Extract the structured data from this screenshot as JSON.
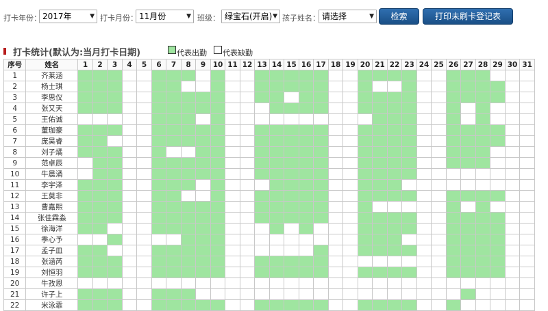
{
  "filters": {
    "year_label": "打卡年份：",
    "year_value": "2017年",
    "month_label": "打卡月份：",
    "month_value": "11月份",
    "class_label": "班级：",
    "class_value": "绿宝石(开启)",
    "child_label": "孩子姓名：",
    "child_value": "请选择",
    "search_button": "检索",
    "print_button": "打印未刷卡登记表"
  },
  "section": {
    "title": "打卡统计(默认为:当月打卡日期)",
    "legend_present": "代表出勤",
    "legend_absent": "代表缺勤"
  },
  "colors": {
    "present": "#9fe5a0",
    "absent": "#ffffff",
    "button": "#1f5a96",
    "title_bar": "#b71c1c"
  },
  "table": {
    "header_index": "序号",
    "header_name": "姓名",
    "days": [
      "1",
      "2",
      "3",
      "4",
      "5",
      "6",
      "7",
      "8",
      "9",
      "10",
      "11",
      "12",
      "13",
      "14",
      "15",
      "16",
      "17",
      "18",
      "19",
      "20",
      "21",
      "22",
      "23",
      "24",
      "25",
      "26",
      "27",
      "28",
      "29",
      "30",
      "31"
    ],
    "rows": [
      {
        "no": "1",
        "name": "齐莱涵",
        "att": "1110011101001111100111100111000"
      },
      {
        "no": "2",
        "name": "杨士琪",
        "att": "1110011001001111100100100111100"
      },
      {
        "no": "3",
        "name": "李思仪",
        "att": "1110011111001101100111100111100"
      },
      {
        "no": "4",
        "name": "张又天",
        "att": "1110011111000111100111100101000"
      },
      {
        "no": "5",
        "name": "王佑诚",
        "att": "0000011101000000000011100101000"
      },
      {
        "no": "6",
        "name": "董珈豪",
        "att": "1110011111001111100111100111100"
      },
      {
        "no": "7",
        "name": "庞昊睿",
        "att": "1100011111001111100111100111100"
      },
      {
        "no": "8",
        "name": "刘子燏",
        "att": "1110010011001111100111100111000"
      },
      {
        "no": "9",
        "name": "范卓辰",
        "att": "0110011111001111100111100111000"
      },
      {
        "no": "10",
        "name": "牛晨涌",
        "att": "0110011111001111100111100000000"
      },
      {
        "no": "11",
        "name": "李宇泽",
        "att": "1110011101000111100111000000000"
      },
      {
        "no": "12",
        "name": "王莫非",
        "att": "1110011001001111100111100111100"
      },
      {
        "no": "13",
        "name": "曹嘉熙",
        "att": "1110011111001111100100000101000"
      },
      {
        "no": "14",
        "name": "张佳霖淼",
        "att": "1110011111001111100111100111100"
      },
      {
        "no": "15",
        "name": "徐海洋",
        "att": "1100011111000101000111100111100"
      },
      {
        "no": "16",
        "name": "季心予",
        "att": "0010000111000000000111000111100"
      },
      {
        "no": "17",
        "name": "孟子皿",
        "att": "1100011111000000100111100111100"
      },
      {
        "no": "18",
        "name": "张涵芮",
        "att": "1110011111001111100000000111100"
      },
      {
        "no": "19",
        "name": "刘恒羽",
        "att": "1110011111001111100111100111100"
      },
      {
        "no": "20",
        "name": "牛孜恩",
        "att": "0000000000000000000000000000000"
      },
      {
        "no": "21",
        "name": "许子上",
        "att": "1110011100000000000000000010000"
      },
      {
        "no": "22",
        "name": "米泳霏",
        "att": "1110011111001111100111100100000"
      }
    ]
  }
}
